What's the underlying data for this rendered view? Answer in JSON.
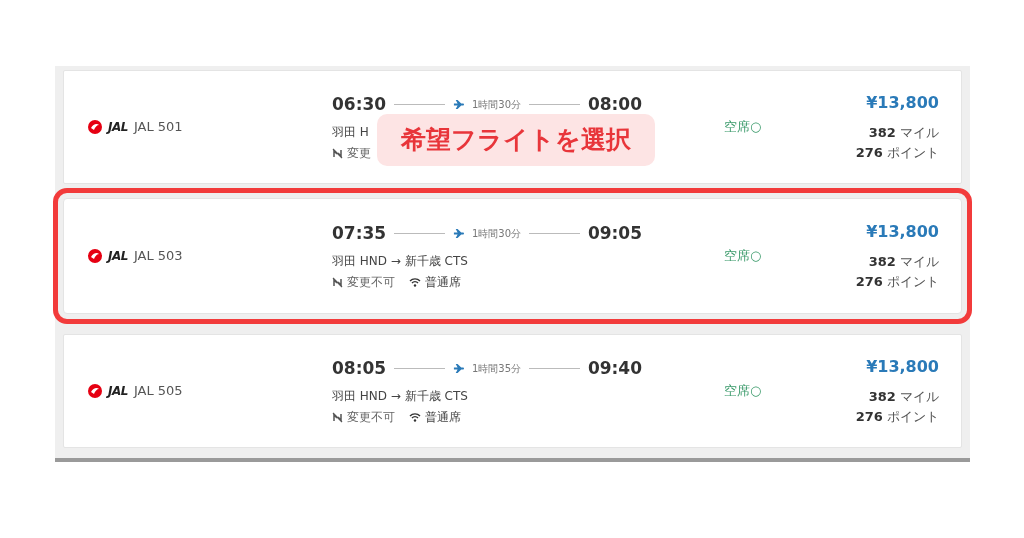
{
  "flights": [
    {
      "airline": "JAL",
      "flight_no": "JAL 501",
      "depart": "06:30",
      "duration": "1時間30分",
      "arrive": "08:00",
      "route": "羽田 H",
      "features": [
        {
          "kind": "change",
          "label": "変更"
        }
      ],
      "seats": "空席○",
      "price": "¥13,800",
      "miles": "**382** マイル",
      "points": "**276** ポイント",
      "selected": false
    },
    {
      "airline": "JAL",
      "flight_no": "JAL 503",
      "depart": "07:35",
      "duration": "1時間30分",
      "arrive": "09:05",
      "route": "羽田 HND → 新千歳 CTS",
      "features": [
        {
          "kind": "change",
          "label": "変更不可"
        },
        {
          "kind": "wifi",
          "label": "普通席"
        }
      ],
      "seats": "空席○",
      "price": "¥13,800",
      "miles": "**382** マイル",
      "points": "**276** ポイント",
      "selected": true
    },
    {
      "airline": "JAL",
      "flight_no": "JAL 505",
      "depart": "08:05",
      "duration": "1時間35分",
      "arrive": "09:40",
      "route": "羽田 HND → 新千歳 CTS",
      "features": [
        {
          "kind": "change",
          "label": "変更不可"
        },
        {
          "kind": "wifi",
          "label": "普通席"
        }
      ],
      "seats": "空席○",
      "price": "¥13,800",
      "miles": "**382** マイル",
      "points": "**276** ポイント",
      "selected": false
    }
  ],
  "callout": {
    "text": "希望フライトを選択"
  }
}
